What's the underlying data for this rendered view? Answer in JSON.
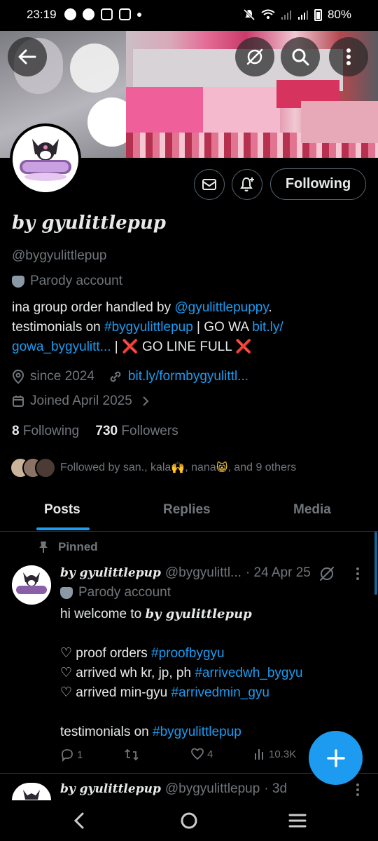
{
  "status_bar": {
    "time": "23:19",
    "battery": "80%"
  },
  "profile": {
    "display_name": "by gyulittlepup",
    "handle": "@bygyulittlepup",
    "parody_label": "Parody account",
    "bio": {
      "line1_prefix": "ina group order handled by ",
      "line1_mention": "@gyulittlepuppy",
      "line1_suffix": ".",
      "line2_prefix": "testimonials on ",
      "line2_tag": "#bygyulittlepup",
      "line2_mid": " | GO WA ",
      "line2_link": "bit.ly/",
      "line3_link": "gowa_bygyulitt...",
      "line3_sep": " | ",
      "line3_x1": "❌",
      "line3_text": " GO LINE FULL ",
      "line3_x2": "❌"
    },
    "since": "since 2024",
    "website": "bit.ly/formbygyulittl...",
    "joined": "Joined April 2025",
    "following_count": "8",
    "following_label": "Following",
    "followers_count": "730",
    "followers_label": "Followers",
    "followed_by_prefix": "Followed by san., kala",
    "followed_by_mid": ", nana",
    "followed_by_suffix": ", and 9 others",
    "follow_button": "Following"
  },
  "tabs": [
    {
      "label": "Posts"
    },
    {
      "label": "Replies"
    },
    {
      "label": "Media"
    }
  ],
  "pinned_post": {
    "pinned_label": "Pinned",
    "author": "by gyulittlepup",
    "handle": "@bygyulittl...",
    "date": "· 24 Apr 25",
    "parody_label": "Parody account",
    "lines": {
      "welcome_prefix": "hi welcome to ",
      "welcome_name": "by gyulittlepup",
      "proof_prefix": "♡ proof orders ",
      "proof_tag": "#proofbygyu",
      "arrived_wh_prefix": "♡ arrived wh kr, jp, ph ",
      "arrived_wh_tag": "#arrivedwh_bygyu",
      "arrived_min_prefix": "♡ arrived min-gyu ",
      "arrived_min_tag": "#arrivedmin_gyu",
      "testimonials_prefix": "testimonials on ",
      "testimonials_tag": "#bygyulittlepup"
    },
    "replies": "1",
    "likes": "4",
    "views": "10.3K"
  },
  "second_post": {
    "author": "by gyulittlepup",
    "handle": "@bygyulittlepup",
    "date": "· 3d"
  },
  "colors": {
    "accent": "#1d9bf0",
    "muted": "#71767b",
    "text": "#e7e9ea",
    "background": "#000000"
  }
}
